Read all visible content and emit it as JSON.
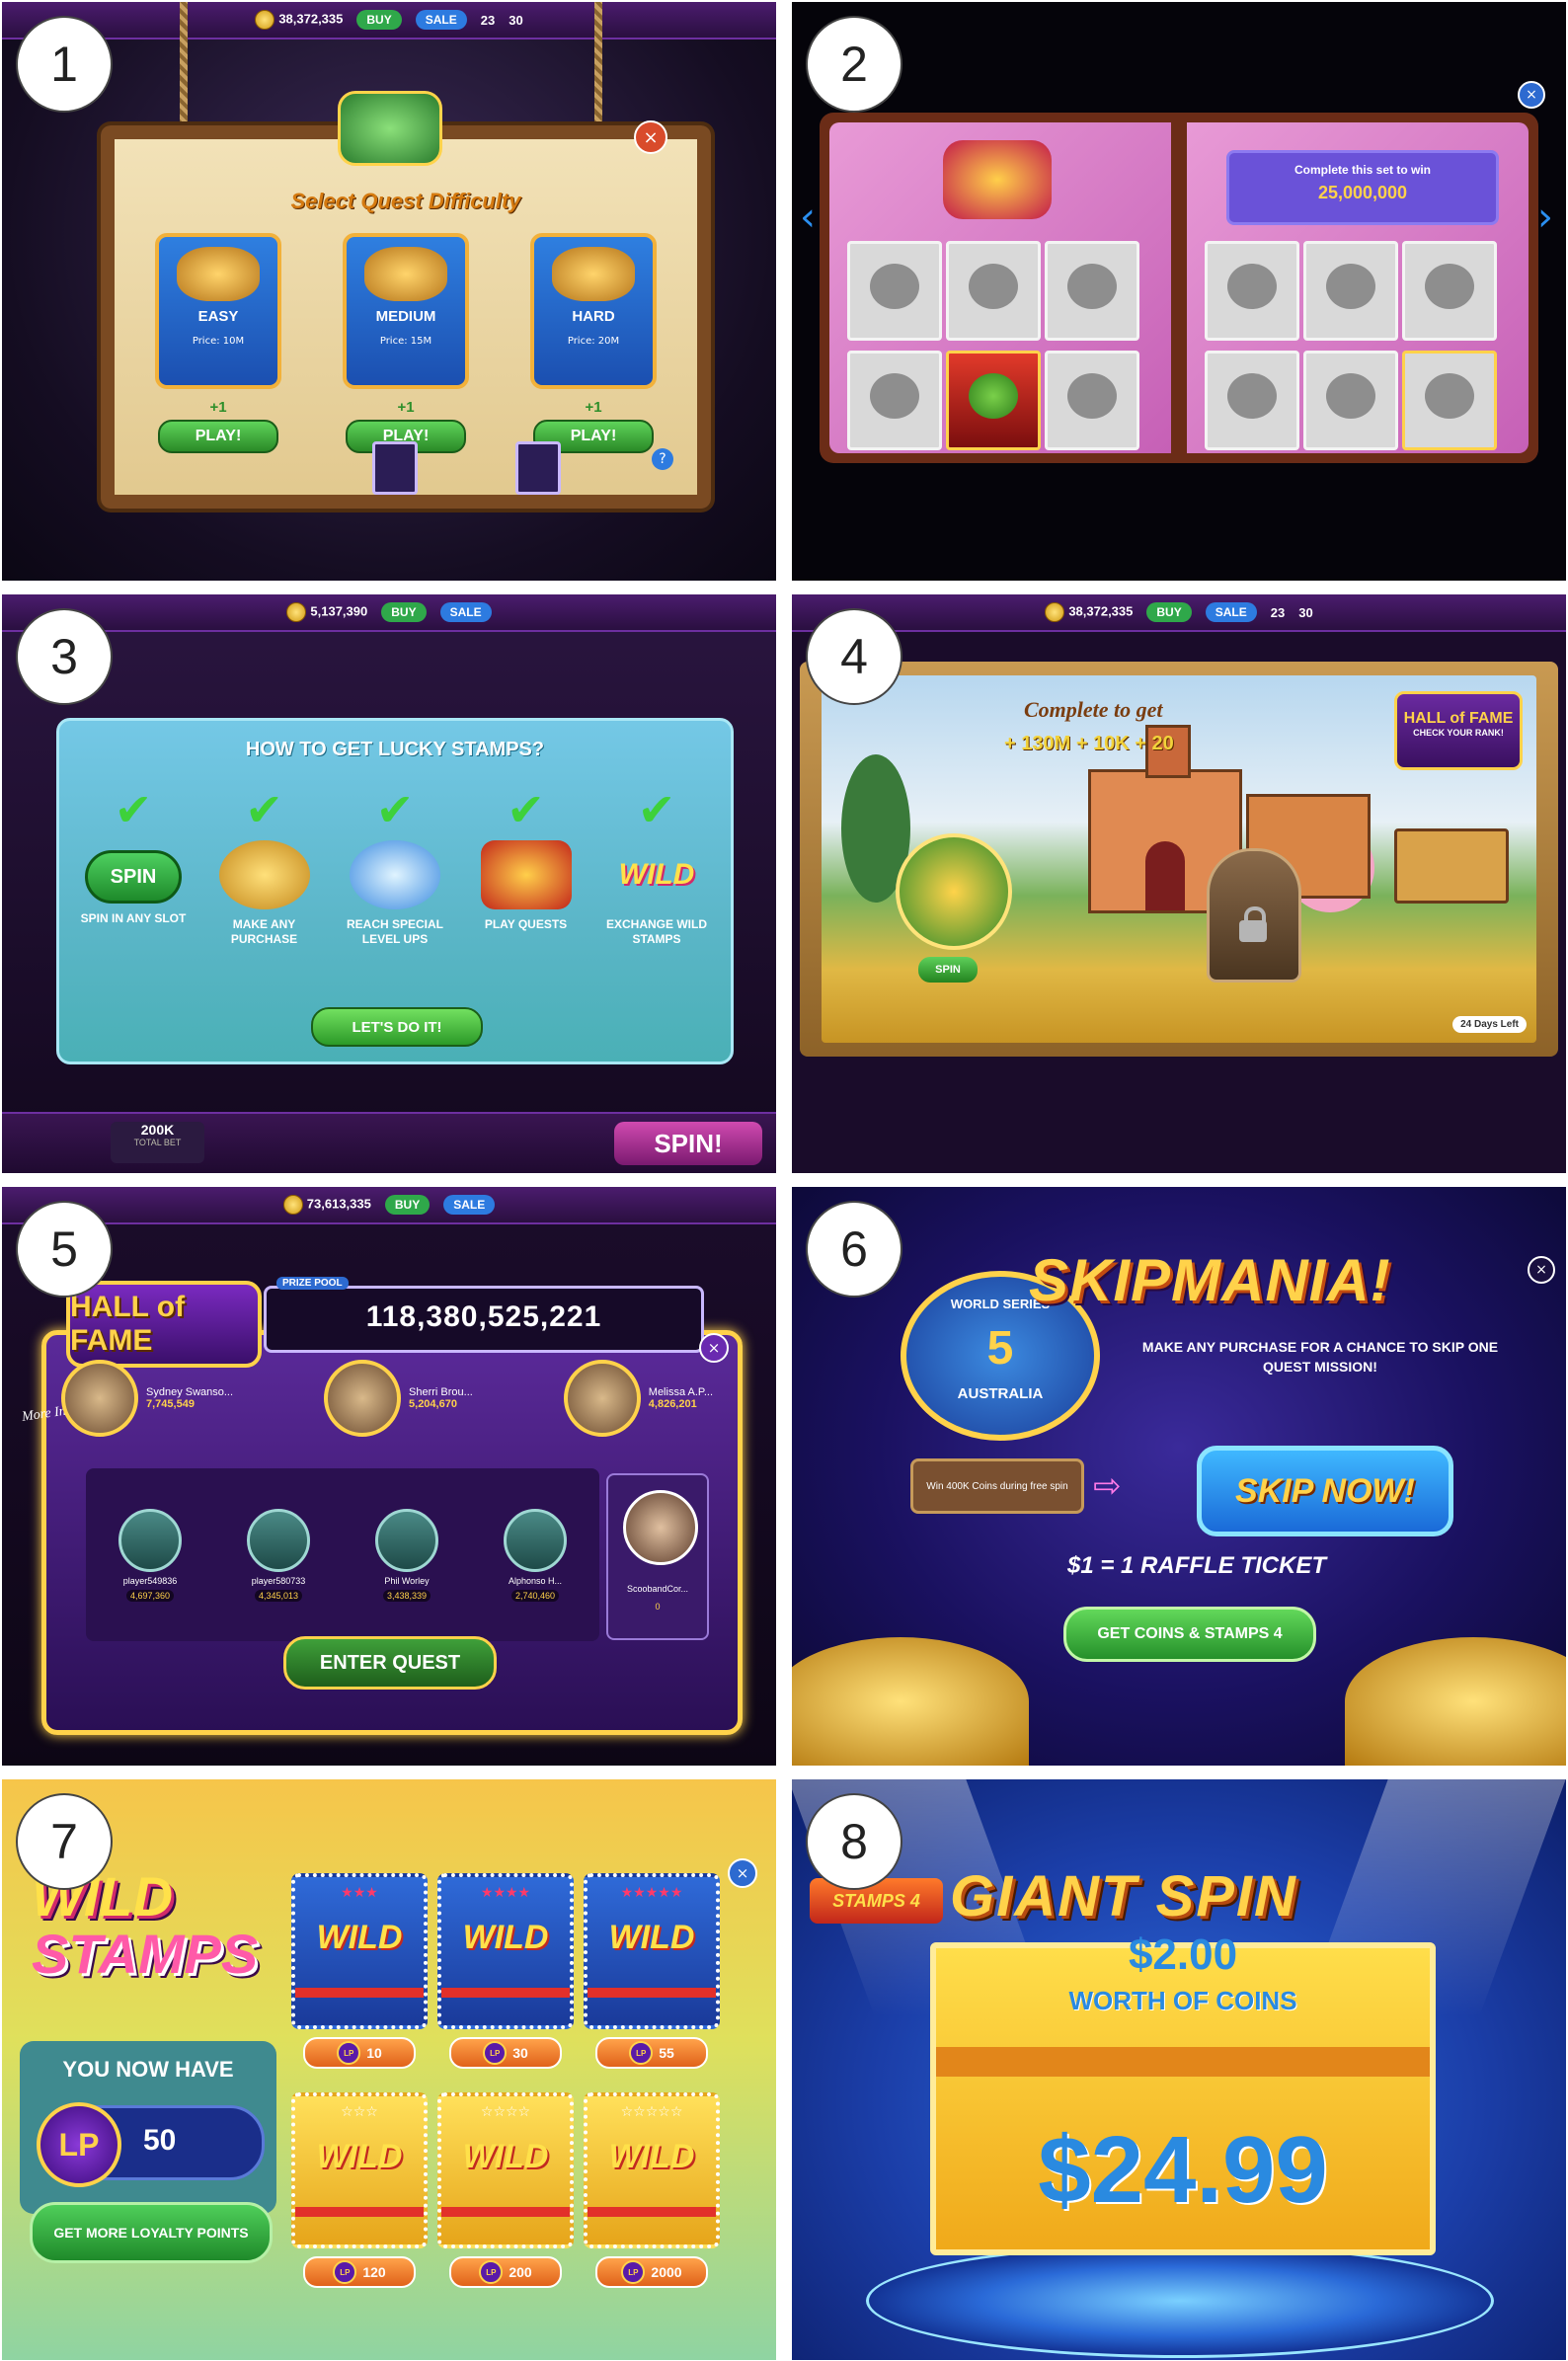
{
  "badges": [
    "1",
    "2",
    "3",
    "4",
    "5",
    "6",
    "7",
    "8"
  ],
  "common": {
    "coins": "38,372,335",
    "buy": "BUY",
    "sale": "SALE",
    "level": "23",
    "gems": "30"
  },
  "panel1": {
    "title": "Select Quest Difficulty",
    "difficulties": [
      {
        "name": "EASY",
        "price": "Price: 10M",
        "reward": "+1",
        "play": "PLAY!"
      },
      {
        "name": "MEDIUM",
        "price": "Price: 15M",
        "reward": "+1",
        "play": "PLAY!"
      },
      {
        "name": "HARD",
        "price": "Price: 20M",
        "reward": "+1",
        "play": "PLAY!"
      }
    ],
    "close": "×",
    "info": "?"
  },
  "panel2": {
    "goal_text": "Complete this set to win",
    "goal_value": "25,000,000",
    "prev": "‹",
    "next": "›",
    "close": "×"
  },
  "panel3": {
    "coins": "5,137,390",
    "title": "HOW TO GET LUCKY STAMPS?",
    "ways": [
      {
        "label": "SPIN IN ANY SLOT",
        "art": "SPIN"
      },
      {
        "label": "MAKE ANY PURCHASE",
        "art": ""
      },
      {
        "label": "REACH SPECIAL LEVEL UPS",
        "art": ""
      },
      {
        "label": "PLAY QUESTS",
        "art": ""
      },
      {
        "label": "EXCHANGE WILD STAMPS",
        "art": "WILD"
      }
    ],
    "button": "LET'S DO IT!",
    "bet": "200K",
    "bet_label": "TOTAL BET",
    "spin": "SPIN!"
  },
  "panel4": {
    "complete": "Complete to get",
    "rewards": "+ 130M + 10K + 20",
    "hof": "HALL of FAME",
    "hof_sub": "CHECK YOUR RANK!",
    "spin": "SPIN",
    "days_left": "24 Days Left"
  },
  "panel5": {
    "coins": "73,613,335",
    "title": "HALL of FAME",
    "prize_label": "PRIZE POOL",
    "prize_pool": "118,380,525,221",
    "more_info": "More Info",
    "leaders": [
      {
        "name": "Sydney Swanso...",
        "score": "7,745,549"
      },
      {
        "name": "Sherri Brou...",
        "score": "5,204,670"
      },
      {
        "name": "Melissa A.P...",
        "score": "4,826,201"
      }
    ],
    "others": [
      {
        "name": "player549836",
        "score": "4,697,360"
      },
      {
        "name": "player580733",
        "score": "4,345,013"
      },
      {
        "name": "Phil Worley",
        "score": "3,438,339"
      },
      {
        "name": "Alphonso H...",
        "score": "2,740,460"
      }
    ],
    "me_name": "ScoobandCor...",
    "me_score": "0",
    "enter": "ENTER QUEST",
    "close": "×"
  },
  "panel6": {
    "badge_top": "WORLD SERIES",
    "badge_num": "5",
    "badge_bottom": "AUSTRALIA",
    "title": "SKIPMANIA!",
    "subtitle": "MAKE ANY PURCHASE FOR A CHANCE TO SKIP ONE QUEST MISSION!",
    "win_board": "Win 400K Coins during free spin",
    "skip": "SKIP NOW!",
    "raffle": "$1 = 1 RAFFLE TICKET",
    "get_coins": "GET COINS & STAMPS 4",
    "close": "×"
  },
  "panel7": {
    "logo_1": "WILD",
    "logo_2": "STAMPS",
    "now_have": "YOU NOW HAVE",
    "lp_icon": "LP",
    "lp_value": "50",
    "more_lp": "GET MORE LOYALTY POINTS",
    "stamps": [
      {
        "stars": "★★★",
        "tone": "blue",
        "price": "10"
      },
      {
        "stars": "★★★★",
        "tone": "blue",
        "price": "30"
      },
      {
        "stars": "★★★★★",
        "tone": "blue",
        "price": "55"
      },
      {
        "stars": "☆☆☆",
        "tone": "gold",
        "price": "120"
      },
      {
        "stars": "☆☆☆☆",
        "tone": "gold",
        "price": "200"
      },
      {
        "stars": "☆☆☆☆☆",
        "tone": "gold",
        "price": "2000"
      }
    ],
    "wild_word": "WILD",
    "close": "×"
  },
  "panel8": {
    "logo": "STAMPS 4",
    "title": "GIANT SPIN",
    "top_value": "$2.00",
    "worth": "WORTH OF COINS",
    "price": "$24.99"
  }
}
